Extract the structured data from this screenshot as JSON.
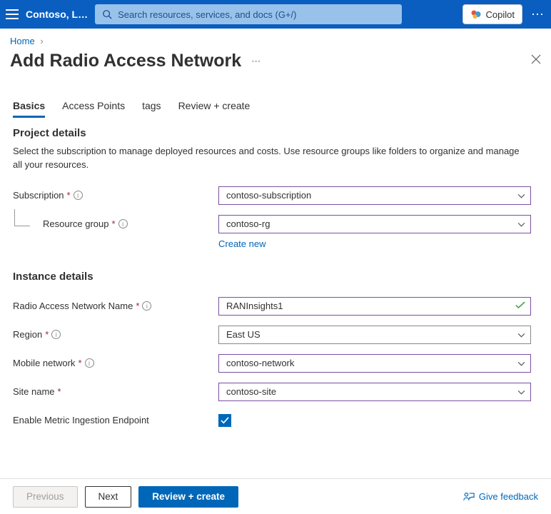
{
  "topbar": {
    "org": "Contoso, L…",
    "search_placeholder": "Search resources, services, and docs (G+/)",
    "copilot": "Copilot"
  },
  "breadcrumb": {
    "home": "Home"
  },
  "title": "Add Radio Access Network",
  "tabs": {
    "basics": "Basics",
    "access_points": "Access Points",
    "tags": "tags",
    "review": "Review + create"
  },
  "sections": {
    "project_title": "Project details",
    "project_desc": "Select the subscription to manage deployed resources and costs. Use resource groups like folders to organize and manage all your resources.",
    "instance_title": "Instance details"
  },
  "labels": {
    "subscription": "Subscription",
    "resource_group": "Resource group",
    "create_new": "Create new",
    "ran_name": "Radio Access Network Name",
    "region": "Region",
    "mobile_network": "Mobile network",
    "site_name": "Site name",
    "enable_metric": "Enable Metric Ingestion Endpoint"
  },
  "values": {
    "subscription": "contoso-subscription",
    "resource_group": "contoso-rg",
    "ran_name": "RANInsights1",
    "region": "East US",
    "mobile_network": "contoso-network",
    "site_name": "contoso-site",
    "enable_metric": true
  },
  "footer": {
    "previous": "Previous",
    "next": "Next",
    "review": "Review + create",
    "feedback": "Give feedback"
  }
}
